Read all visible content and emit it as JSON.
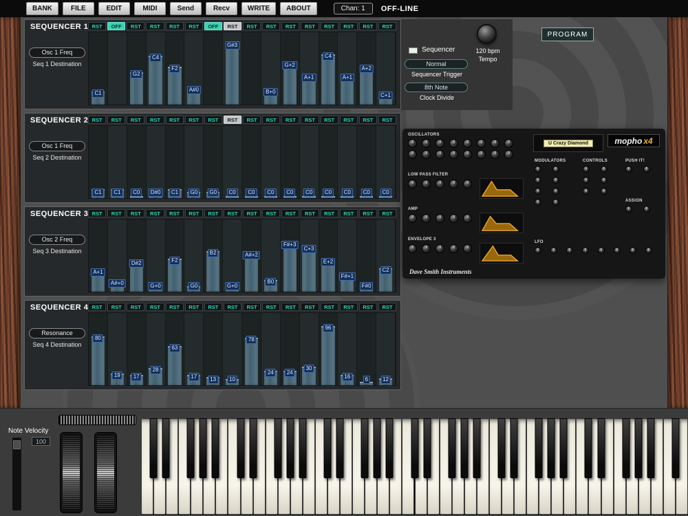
{
  "colors": {
    "accent_teal": "#2ed3b5",
    "bar_blue": "#4e6a78",
    "note_label_bg": "#142f58",
    "note_label_border": "#416fb0",
    "wood_brown": "#6b3a26",
    "logo_yellow": "#e8b428"
  },
  "menu": {
    "items": [
      {
        "label": "BANK"
      },
      {
        "label": "FILE"
      },
      {
        "label": "EDIT"
      },
      {
        "label": "MIDI"
      },
      {
        "label": "Send"
      },
      {
        "label": "Recv"
      },
      {
        "label": "WRITE"
      },
      {
        "label": "ABOUT"
      }
    ],
    "channel": "Chan: 1",
    "status": "OFF-LINE"
  },
  "transport": {
    "sequencer_label": "Sequencer",
    "trigger_value": "Normal",
    "trigger_label": "Sequencer Trigger",
    "clock_value": "8th Note",
    "clock_label": "Clock Divide",
    "tempo_value": "120 bpm",
    "tempo_label": "Tempo",
    "program_button": "PROGRAM"
  },
  "sequencers": [
    {
      "title": "SEQUENCER 1",
      "destination": "Osc 1 Freq",
      "destination_label": "Seq 1 Destination",
      "steps": [
        {
          "button": "RST",
          "state": "normal",
          "note": "C1",
          "height": 18
        },
        {
          "button": "OFF",
          "state": "active-off",
          "note": "",
          "height": 0
        },
        {
          "button": "RST",
          "state": "normal",
          "note": "G2",
          "height": 45
        },
        {
          "button": "RST",
          "state": "normal",
          "note": "C4",
          "height": 68
        },
        {
          "button": "RST",
          "state": "normal",
          "note": "F2",
          "height": 52
        },
        {
          "button": "RST",
          "state": "normal",
          "note": "A#0",
          "height": 23
        },
        {
          "button": "OFF",
          "state": "active-off",
          "note": "",
          "height": 0
        },
        {
          "button": "RST",
          "state": "active-rst",
          "note": "G#3",
          "height": 85
        },
        {
          "button": "RST",
          "state": "normal",
          "note": "",
          "height": 0
        },
        {
          "button": "RST",
          "state": "normal",
          "note": "B+0",
          "height": 20
        },
        {
          "button": "RST",
          "state": "normal",
          "note": "G+2",
          "height": 57
        },
        {
          "button": "RST",
          "state": "normal",
          "note": "A+1",
          "height": 40
        },
        {
          "button": "RST",
          "state": "normal",
          "note": "C4",
          "height": 70
        },
        {
          "button": "RST",
          "state": "normal",
          "note": "A+1",
          "height": 40
        },
        {
          "button": "RST",
          "state": "normal",
          "note": "A+2",
          "height": 52
        },
        {
          "button": "RST",
          "state": "normal",
          "note": "C+1",
          "height": 15
        }
      ]
    },
    {
      "title": "SEQUENCER 2",
      "destination": "Osc 1 Freq",
      "destination_label": "Seq 2 Destination",
      "steps": [
        {
          "button": "RST",
          "state": "normal",
          "note": "C1",
          "height": 12
        },
        {
          "button": "RST",
          "state": "normal",
          "note": "C1",
          "height": 12
        },
        {
          "button": "RST",
          "state": "normal",
          "note": "C0",
          "height": 3
        },
        {
          "button": "RST",
          "state": "normal",
          "note": "D#0",
          "height": 7
        },
        {
          "button": "RST",
          "state": "normal",
          "note": "C1",
          "height": 12
        },
        {
          "button": "RST",
          "state": "normal",
          "note": "G0",
          "height": 9
        },
        {
          "button": "RST",
          "state": "normal",
          "note": "G0",
          "height": 9
        },
        {
          "button": "RST",
          "state": "active-rst",
          "note": "C0",
          "height": 3
        },
        {
          "button": "RST",
          "state": "normal",
          "note": "C0",
          "height": 3
        },
        {
          "button": "RST",
          "state": "normal",
          "note": "C0",
          "height": 3
        },
        {
          "button": "RST",
          "state": "normal",
          "note": "C0",
          "height": 3
        },
        {
          "button": "RST",
          "state": "normal",
          "note": "C0",
          "height": 3
        },
        {
          "button": "RST",
          "state": "normal",
          "note": "C0",
          "height": 3
        },
        {
          "button": "RST",
          "state": "normal",
          "note": "C0",
          "height": 3
        },
        {
          "button": "RST",
          "state": "normal",
          "note": "C0",
          "height": 3
        },
        {
          "button": "RST",
          "state": "normal",
          "note": "C0",
          "height": 3
        }
      ]
    },
    {
      "title": "SEQUENCER 3",
      "destination": "Osc 2 Freq",
      "destination_label": "Seq 3 Destination",
      "steps": [
        {
          "button": "RST",
          "state": "normal",
          "note": "A+1",
          "height": 30
        },
        {
          "button": "RST",
          "state": "normal",
          "note": "A#+0",
          "height": 14
        },
        {
          "button": "RST",
          "state": "normal",
          "note": "D#2",
          "height": 42
        },
        {
          "button": "RST",
          "state": "normal",
          "note": "G+0",
          "height": 8
        },
        {
          "button": "RST",
          "state": "normal",
          "note": "F2",
          "height": 46
        },
        {
          "button": "RST",
          "state": "normal",
          "note": "G0",
          "height": 8
        },
        {
          "button": "RST",
          "state": "normal",
          "note": "B2",
          "height": 56
        },
        {
          "button": "RST",
          "state": "normal",
          "note": "G+0",
          "height": 8
        },
        {
          "button": "RST",
          "state": "normal",
          "note": "A#+2",
          "height": 53
        },
        {
          "button": "RST",
          "state": "normal",
          "note": "B0",
          "height": 16
        },
        {
          "button": "RST",
          "state": "normal",
          "note": "F#+3",
          "height": 68
        },
        {
          "button": "RST",
          "state": "normal",
          "note": "C+3",
          "height": 62
        },
        {
          "button": "RST",
          "state": "normal",
          "note": "E+2",
          "height": 44
        },
        {
          "button": "RST",
          "state": "normal",
          "note": "F#+1",
          "height": 24
        },
        {
          "button": "RST",
          "state": "normal",
          "note": "F#0",
          "height": 8
        },
        {
          "button": "RST",
          "state": "normal",
          "note": "C2",
          "height": 32
        }
      ]
    },
    {
      "title": "SEQUENCER 4",
      "destination": "Resonance",
      "destination_label": "Seq 4 Destination",
      "steps": [
        {
          "button": "RST",
          "state": "normal",
          "note": "80",
          "height": 68
        },
        {
          "button": "RST",
          "state": "normal",
          "note": "19",
          "height": 16
        },
        {
          "button": "RST",
          "state": "normal",
          "note": "17",
          "height": 14
        },
        {
          "button": "RST",
          "state": "normal",
          "note": "28",
          "height": 24
        },
        {
          "button": "RST",
          "state": "normal",
          "note": "63",
          "height": 54
        },
        {
          "button": "RST",
          "state": "normal",
          "note": "17",
          "height": 14
        },
        {
          "button": "RST",
          "state": "normal",
          "note": "13",
          "height": 11
        },
        {
          "button": "RST",
          "state": "normal",
          "note": "10",
          "height": 9
        },
        {
          "button": "RST",
          "state": "normal",
          "note": "78",
          "height": 66
        },
        {
          "button": "RST",
          "state": "normal",
          "note": "24",
          "height": 20
        },
        {
          "button": "RST",
          "state": "normal",
          "note": "24",
          "height": 20
        },
        {
          "button": "RST",
          "state": "normal",
          "note": "30",
          "height": 26
        },
        {
          "button": "RST",
          "state": "normal",
          "note": "96",
          "height": 82
        },
        {
          "button": "RST",
          "state": "normal",
          "note": "16",
          "height": 14
        },
        {
          "button": "RST",
          "state": "normal",
          "note": "6",
          "height": 5
        },
        {
          "button": "RST",
          "state": "normal",
          "note": "12",
          "height": 10
        }
      ]
    }
  ],
  "synth": {
    "logo_main": "mopho",
    "logo_suffix": "x4",
    "brand": "Dave Smith Instruments",
    "display_program": "U Crazy Diamond",
    "sections": {
      "oscillators": "OSCILLATORS",
      "low_pass_filter": "LOW PASS FILTER",
      "amp": "AMP",
      "envelope_3": "ENVELOPE 3",
      "modulators": "MODULATORS",
      "controls": "CONTROLS",
      "push_it": "PUSH IT!",
      "assign": "ASSIGN",
      "lfo": "LFO"
    }
  },
  "keyboard": {
    "velocity_label": "Note Velocity",
    "velocity_value": "100",
    "white_key_count": 44
  }
}
